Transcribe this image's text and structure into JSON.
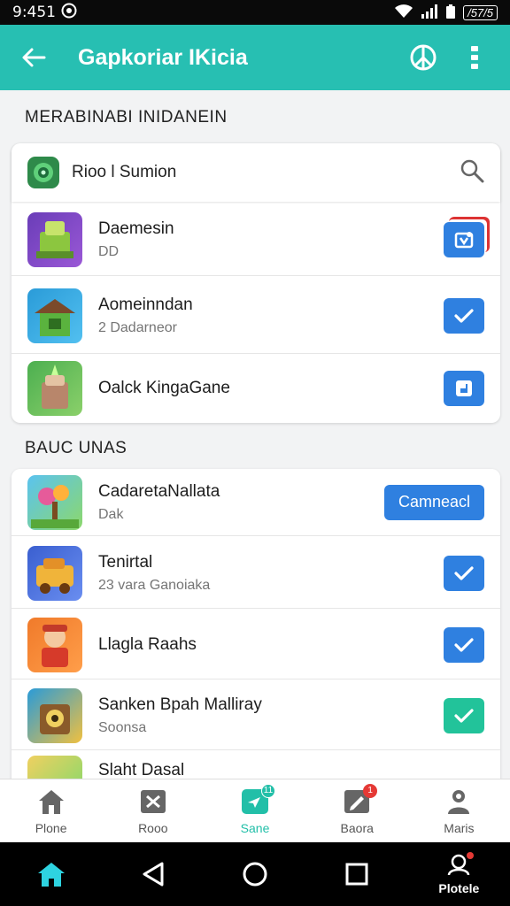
{
  "status_bar": {
    "time": "9:451",
    "battery": "/57/5"
  },
  "app_bar": {
    "title": "Gapkoriar IKicia"
  },
  "section1": {
    "title": "MERABINABI INIDANEIN",
    "search": {
      "label": "Rioo l Sumion"
    },
    "items": [
      {
        "title": "Daemesin",
        "subtitle": "DD"
      },
      {
        "title": "Aomeinndan",
        "subtitle": "2 Dadarneor"
      },
      {
        "title": "Oalck KingaGane",
        "subtitle": ""
      }
    ]
  },
  "section2": {
    "title": "BAUC UNAS",
    "items": [
      {
        "title": "CadaretaNallata",
        "subtitle": "Dak",
        "action_label": "Camneacl"
      },
      {
        "title": "Tenirtal",
        "subtitle": "23 vara Ganoiaka"
      },
      {
        "title": "Llagla Raahs",
        "subtitle": ""
      },
      {
        "title": "Sanken Bpah Malliray",
        "subtitle": "Soonsa"
      },
      {
        "title": "Slaht Dasal",
        "subtitle": ""
      }
    ]
  },
  "bottom_nav": {
    "items": [
      {
        "label": "Plone"
      },
      {
        "label": "Rooo"
      },
      {
        "label": "Sane",
        "badge": "11"
      },
      {
        "label": "Baora",
        "badge": "1"
      },
      {
        "label": "Maris"
      }
    ]
  },
  "system_nav": {
    "profile_label": "Plotele"
  },
  "colors": {
    "accent": "#27bfb2",
    "primary_blue": "#2f80e0",
    "teal_check": "#22c39a",
    "alert_red": "#e53935"
  }
}
